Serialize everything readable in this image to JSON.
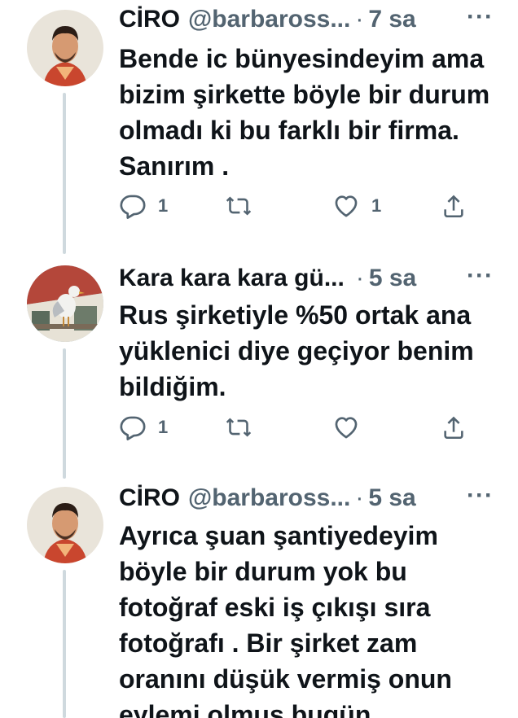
{
  "tweets": [
    {
      "name": "CİRO",
      "handle": "@barbaross...",
      "time": "7 sa",
      "text": "Bende ic bünyesindeyim ama bizim şirkette böyle bir durum olmadı ki bu farklı bir firma. Sanırım .",
      "replies": "1",
      "retweets": "",
      "likes": "1",
      "avatar": "avatar-man"
    },
    {
      "name": "Kara kara kara gü...",
      "handle": "",
      "time": "5 sa",
      "text": "Rus şirketiyle %50 ortak ana yüklenici diye geçiyor benim bildiğim.",
      "replies": "1",
      "retweets": "",
      "likes": "",
      "avatar": "avatar-seagull"
    },
    {
      "name": "CİRO",
      "handle": "@barbaross...",
      "time": "5 sa",
      "text": "Ayrıca şuan şantiyedeyim böyle bir durum yok bu fotoğraf eski iş çıkışı sıra fotoğrafı . Bir şirket zam oranını düşük vermiş onun eylemi olmuş bugün",
      "avatar": "avatar-man"
    }
  ],
  "icons": {
    "reply": "reply-icon",
    "retweet": "retweet-icon",
    "like": "heart-icon",
    "share": "share-icon",
    "more": "more-icon"
  },
  "colors": {
    "text": "#0f1419",
    "secondary": "#536471",
    "thread_line": "#cfd9de"
  }
}
